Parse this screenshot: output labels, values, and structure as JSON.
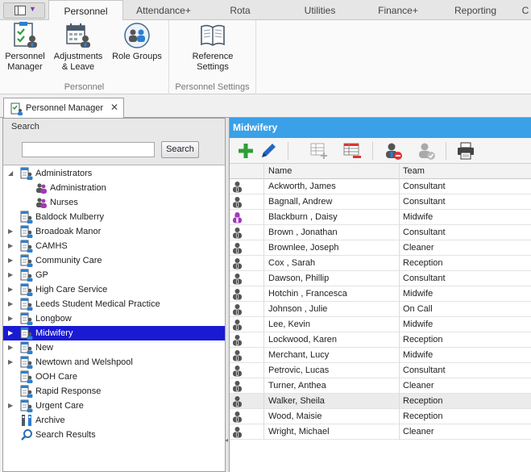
{
  "ribbon": {
    "tabs": [
      "Personnel",
      "Attendance+",
      "Rota",
      "Utilities",
      "Finance+",
      "Reporting",
      "C"
    ],
    "active_tab": "Personnel",
    "groups": [
      {
        "label": "Personnel",
        "buttons": [
          "Personnel Manager",
          "Adjustments & Leave",
          "Role Groups"
        ]
      },
      {
        "label": "Personnel Settings",
        "buttons": [
          "Reference Settings"
        ]
      }
    ],
    "btn_labels": {
      "personnel_manager_1": "Personnel",
      "personnel_manager_2": "Manager",
      "adjustments_1": "Adjustments",
      "adjustments_2": "& Leave",
      "role_groups": "Role Groups",
      "reference_1": "Reference",
      "reference_2": "Settings"
    }
  },
  "doc_tab": {
    "title": "Personnel Manager",
    "close": "✕"
  },
  "search": {
    "label": "Search",
    "value": "",
    "button": "Search"
  },
  "tree": [
    {
      "label": "Administrators",
      "expander": "expanded",
      "level": 0
    },
    {
      "label": "Administration",
      "expander": "none",
      "level": 1
    },
    {
      "label": "Nurses",
      "expander": "none",
      "level": 1
    },
    {
      "label": "Baldock Mulberry",
      "expander": "none",
      "level": 0
    },
    {
      "label": "Broadoak Manor",
      "expander": "collapsed",
      "level": 0
    },
    {
      "label": "CAMHS",
      "expander": "collapsed",
      "level": 0
    },
    {
      "label": "Community Care",
      "expander": "collapsed",
      "level": 0
    },
    {
      "label": "GP",
      "expander": "collapsed",
      "level": 0
    },
    {
      "label": "High Care Service",
      "expander": "collapsed",
      "level": 0
    },
    {
      "label": "Leeds Student Medical Practice",
      "expander": "collapsed",
      "level": 0
    },
    {
      "label": "Longbow",
      "expander": "collapsed",
      "level": 0
    },
    {
      "label": "Midwifery",
      "expander": "collapsed",
      "level": 0,
      "selected": true
    },
    {
      "label": "New",
      "expander": "collapsed",
      "level": 0
    },
    {
      "label": "Newtown and Welshpool",
      "expander": "collapsed",
      "level": 0
    },
    {
      "label": "OOH Care",
      "expander": "none",
      "level": 0
    },
    {
      "label": "Rapid Response",
      "expander": "none",
      "level": 0
    },
    {
      "label": "Urgent Care",
      "expander": "collapsed",
      "level": 0
    },
    {
      "label": "Archive",
      "expander": "none",
      "level": 0,
      "icon": "archive-icon"
    },
    {
      "label": "Search Results",
      "expander": "none",
      "level": 0,
      "icon": "magnifier-icon"
    }
  ],
  "group_panel": {
    "title": "Midwifery",
    "header_color": "#3aa0e8",
    "columns": [
      "",
      "Name",
      "Team"
    ],
    "rows": [
      {
        "name": "Ackworth, James",
        "team": "Consultant",
        "icon": "male-person-icon"
      },
      {
        "name": "Bagnall, Andrew",
        "team": "Consultant",
        "icon": "male-person-icon"
      },
      {
        "name": "Blackburn , Daisy",
        "team": "Midwife",
        "icon": "female-person-icon"
      },
      {
        "name": "Brown , Jonathan",
        "team": "Consultant",
        "icon": "male-person-icon"
      },
      {
        "name": "Brownlee, Joseph",
        "team": "Cleaner",
        "icon": "male-person-icon"
      },
      {
        "name": "Cox , Sarah",
        "team": "Reception",
        "icon": "male-person-icon"
      },
      {
        "name": "Dawson, Phillip",
        "team": "Consultant",
        "icon": "male-person-icon"
      },
      {
        "name": "Hotchin , Francesca",
        "team": "Midwife",
        "icon": "male-person-icon"
      },
      {
        "name": "Johnson , Julie",
        "team": "On Call",
        "icon": "male-person-icon"
      },
      {
        "name": "Lee, Kevin",
        "team": "Midwife",
        "icon": "male-person-icon"
      },
      {
        "name": "Lockwood, Karen",
        "team": "Reception",
        "icon": "male-person-icon"
      },
      {
        "name": "Merchant, Lucy",
        "team": "Midwife",
        "icon": "male-person-icon"
      },
      {
        "name": "Petrovic, Lucas",
        "team": "Consultant",
        "icon": "male-person-icon"
      },
      {
        "name": "Turner, Anthea",
        "team": "Cleaner",
        "icon": "male-person-icon"
      },
      {
        "name": "Walker, Sheila",
        "team": "Reception",
        "icon": "male-person-icon",
        "highlighted": true
      },
      {
        "name": "Wood, Maisie",
        "team": "Reception",
        "icon": "male-person-icon"
      },
      {
        "name": "Wright, Michael",
        "team": "Cleaner",
        "icon": "male-person-icon"
      }
    ]
  },
  "colors": {
    "selection": "#1a1ad3",
    "accent": "#3aa0e8",
    "add_green": "#2e9e3a",
    "edit_blue": "#2468c4",
    "remove_red": "#d33"
  }
}
